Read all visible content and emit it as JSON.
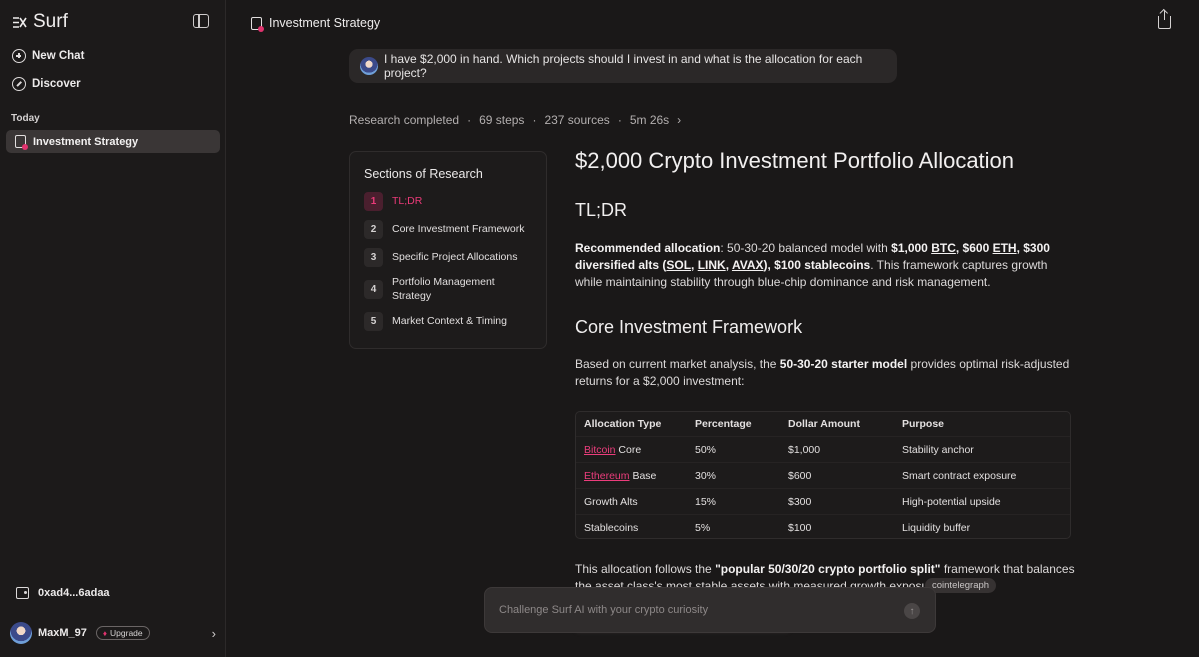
{
  "app": {
    "name": "Surf",
    "accent": "#e0336e"
  },
  "sidebar": {
    "new_chat": "New Chat",
    "discover": "Discover",
    "section_label": "Today",
    "active_chat": "Investment Strategy",
    "wallet": "0xad4...6adaa",
    "username": "MaxM_97",
    "upgrade": "Upgrade"
  },
  "header": {
    "title": "Investment Strategy"
  },
  "question": "I have $2,000 in hand. Which projects should I invest in and what is the allocation for each project?",
  "status": {
    "completed": "Research completed",
    "steps": "69 steps",
    "sources": "237 sources",
    "time": "5m 26s",
    "sep": "·"
  },
  "sections": {
    "title": "Sections of Research",
    "items": [
      {
        "num": "1",
        "label": "TL;DR"
      },
      {
        "num": "2",
        "label": "Core Investment Framework"
      },
      {
        "num": "3",
        "label": "Specific Project Allocations"
      },
      {
        "num": "4",
        "label": "Portfolio Management Strategy"
      },
      {
        "num": "5",
        "label": "Market Context & Timing"
      }
    ]
  },
  "report": {
    "title": "$2,000 Crypto Investment Portfolio Allocation",
    "tldr_heading": "TL;DR",
    "tldr": {
      "lead": "Recommended allocation",
      "t1": ": 50-30-20 balanced model with ",
      "b1": "$1,000 ",
      "btc": "BTC",
      "b2": ", $600 ",
      "eth": "ETH",
      "b3": ", $300 diversified alts (",
      "sol": "SOL",
      "c1": ", ",
      "link": "LINK",
      "c2": ", ",
      "avax": "AVAX",
      "b4": "), $100 stablecoins",
      "t2": ". This framework captures growth while maintaining stability through blue-chip dominance and risk management."
    },
    "core_heading": "Core Investment Framework",
    "core_para": {
      "t1": "Based on current market analysis, the ",
      "b1": "50-30-20 starter model",
      "t2": " provides optimal risk-adjusted returns for a $2,000 investment:"
    },
    "table": {
      "headers": [
        "Allocation Type",
        "Percentage",
        "Dollar Amount",
        "Purpose"
      ],
      "rows": [
        {
          "link": "Bitcoin",
          "type": " Core",
          "pct": "50%",
          "amt": "$1,000",
          "purpose": "Stability anchor"
        },
        {
          "link": "Ethereum",
          "type": " Base",
          "pct": "30%",
          "amt": "$600",
          "purpose": "Smart contract exposure"
        },
        {
          "link": "",
          "type": "Growth Alts",
          "pct": "15%",
          "amt": "$300",
          "purpose": "High-potential upside"
        },
        {
          "link": "",
          "type": "Stablecoins",
          "pct": "5%",
          "amt": "$100",
          "purpose": "Liquidity buffer"
        }
      ]
    },
    "follow": {
      "t1": "This allocation follows the ",
      "b1": "\"popular 50/30/20 crypto portfolio split\"",
      "t2": " framework that balances the asset class's most stable assets with measured growth exposure."
    },
    "source_chip": "cointelegraph"
  },
  "chat_input": {
    "placeholder": "Challenge Surf AI with your crypto curiosity"
  }
}
